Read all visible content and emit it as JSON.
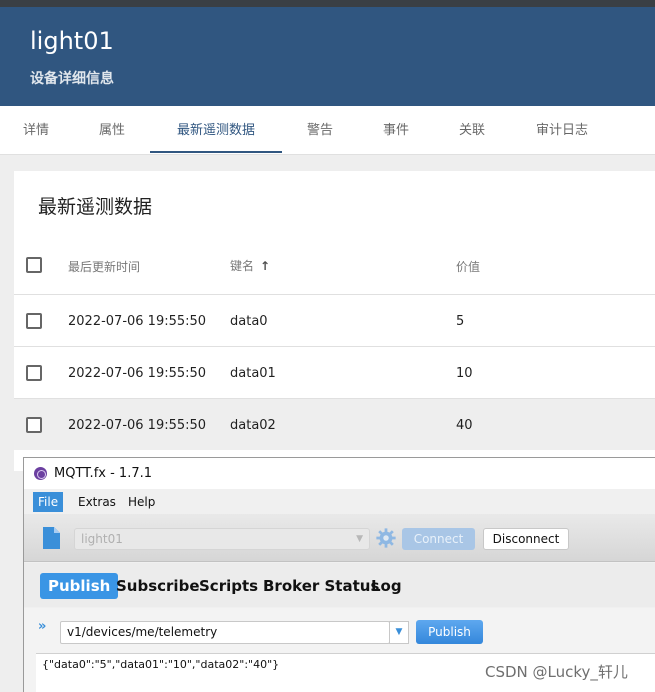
{
  "device": {
    "name": "light01",
    "subtitle": "设备详细信息"
  },
  "tabs": [
    {
      "label": "详情"
    },
    {
      "label": "属性"
    },
    {
      "label": "最新遥测数据",
      "active": true
    },
    {
      "label": "警告"
    },
    {
      "label": "事件"
    },
    {
      "label": "关联"
    },
    {
      "label": "审计日志"
    }
  ],
  "telemetry": {
    "title": "最新遥测数据",
    "columns": {
      "updated": "最后更新时间",
      "key": "键名",
      "value": "价值"
    },
    "sort_icon": "arrow-up-icon",
    "rows": [
      {
        "updated": "2022-07-06 19:55:50",
        "key": "data0",
        "value": "5"
      },
      {
        "updated": "2022-07-06 19:55:50",
        "key": "data01",
        "value": "10"
      },
      {
        "updated": "2022-07-06 19:55:50",
        "key": "data02",
        "value": "40"
      }
    ]
  },
  "mqttfx": {
    "window_title": "MQTT.fx - 1.7.1",
    "menu": [
      "File",
      "Extras",
      "Help"
    ],
    "profile": "light01",
    "connect_label": "Connect",
    "disconnect_label": "Disconnect",
    "tabs": [
      "Publish",
      "Subscribe",
      "Scripts",
      "Broker Status",
      "Log"
    ],
    "topic": "v1/devices/me/telemetry",
    "publish_label": "Publish",
    "payload": "{\"data0\":\"5\",\"data01\":\"10\",\"data02\":\"40\"}"
  },
  "watermark": "CSDN @Lucky_轩儿",
  "colors": {
    "header_bg": "#305680",
    "accent_blue": "#3a95e5"
  }
}
